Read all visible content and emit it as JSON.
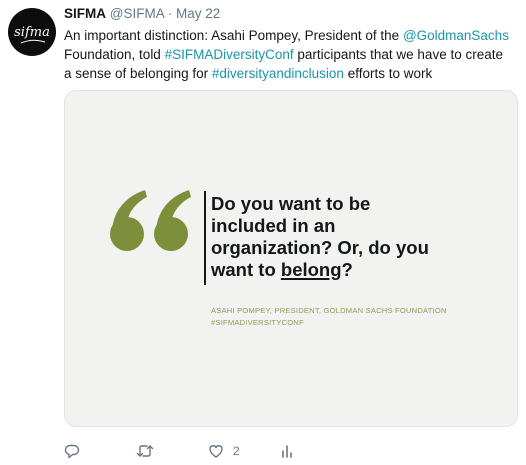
{
  "tweet": {
    "avatar_text": "sifma",
    "name": "SIFMA",
    "handle": "@SIFMA",
    "separator": "·",
    "date": "May 22",
    "text_1": "An important distinction: Asahi Pompey, President of the ",
    "mention": "@GoldmanSachs",
    "text_2": " Foundation, told ",
    "hashtag_1": "#SIFMADiversityConf",
    "text_3": " participants that we have to create a sense of belonging for ",
    "hashtag_2": "#diversityandinclusion",
    "text_4": " efforts to work"
  },
  "card": {
    "quote_part_1": "Do you want to be included in an organization? Or, do you want to ",
    "quote_underlined": "belong",
    "quote_part_2": "?",
    "attribution_line_1": "ASAHI POMPEY, PRESIDENT, GOLDMAN SACHS FOUNDATION",
    "attribution_line_2": "#SIFMADIVERSITYCONF",
    "quote_color": "#7d8f3b"
  },
  "actions": {
    "reply_icon": "reply-icon",
    "retweet_icon": "retweet-icon",
    "like_icon": "heart-icon",
    "like_count": "2",
    "analytics_icon": "analytics-icon"
  },
  "colors": {
    "link": "#1b95a6",
    "secondary_text": "#657786",
    "card_background": "#f2f2f0",
    "attribution": "#8aa15a"
  }
}
